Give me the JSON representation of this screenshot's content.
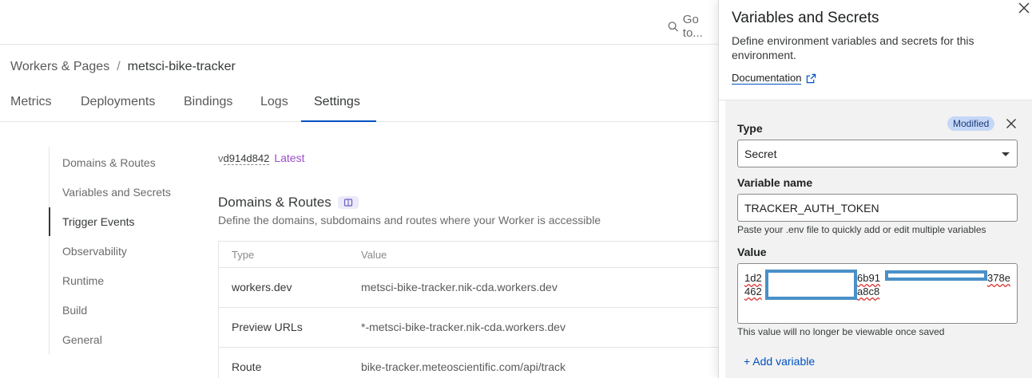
{
  "topbar": {
    "goto_label": "Go to..."
  },
  "breadcrumb": {
    "root": "Workers & Pages",
    "separator": "/",
    "current": "metsci-bike-tracker"
  },
  "tabs": [
    "Metrics",
    "Deployments",
    "Bindings",
    "Logs",
    "Settings"
  ],
  "active_tab": "Settings",
  "leftnav": [
    "Domains & Routes",
    "Variables and Secrets",
    "Trigger Events",
    "Observability",
    "Runtime",
    "Build",
    "General"
  ],
  "version": {
    "prefix": "v",
    "hash": "d914d842",
    "badge": "Latest"
  },
  "section": {
    "title": "Domains & Routes",
    "description": "Define the domains, subdomains and routes where your Worker is accessible"
  },
  "routes_table": {
    "headers": [
      "Type",
      "Value"
    ],
    "rows": [
      {
        "type": "workers.dev",
        "value": "metsci-bike-tracker.nik-cda.workers.dev"
      },
      {
        "type": "Preview URLs",
        "value": "*-metsci-bike-tracker.nik-cda.workers.dev"
      },
      {
        "type": "Route",
        "value": "bike-tracker.meteoscientific.com/api/track"
      }
    ]
  },
  "panel": {
    "title": "Variables and Secrets",
    "description": "Define environment variables and secrets for this environment.",
    "doc_link": "Documentation",
    "type_label": "Type",
    "modified_badge": "Modified",
    "type_value": "Secret",
    "name_label": "Variable name",
    "name_value": "TRACKER_AUTH_TOKEN",
    "name_hint": "Paste your .env file to quickly add or edit multiple variables",
    "value_label": "Value",
    "value_fragments": [
      "1d2",
      "6b91",
      "378e",
      "462",
      "a8c8"
    ],
    "value_hint": "This value will no longer be viewable once saved",
    "add_variable": "+ Add variable"
  },
  "colors": {
    "link": "#0051c3",
    "latest": "#9b4dca",
    "modified_bg": "#c5d7f7",
    "redaction": "#4a90c8"
  }
}
